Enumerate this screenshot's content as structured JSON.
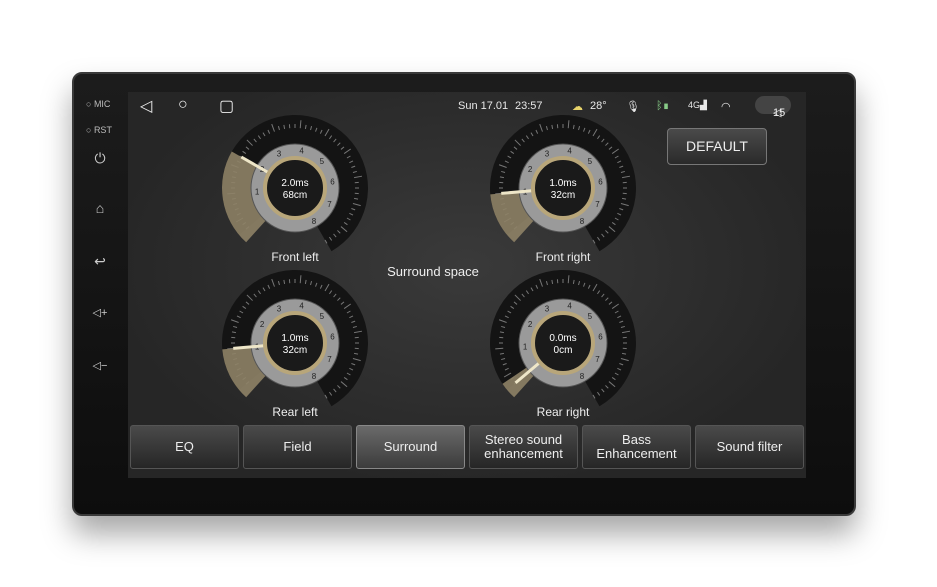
{
  "side": {
    "mic": "MIC",
    "rst": "RST",
    "icons": [
      "power-icon",
      "home-icon",
      "back-icon",
      "volume-up-icon",
      "volume-down-icon"
    ]
  },
  "status": {
    "date": "Sun 17.01",
    "time": "23:57",
    "temperature": "28°",
    "volume": "15",
    "icons": [
      "back-nav-icon",
      "home-nav-icon",
      "recents-nav-icon",
      "weather-icon",
      "mic-icon",
      "bluetooth-icon",
      "signal-4g-icon",
      "wifi-icon",
      "volume-icon"
    ]
  },
  "default_label": "DEFAULT",
  "title": "Surround space",
  "gauges": [
    {
      "name": "Front left",
      "delay": "2.0ms",
      "distance": "68cm",
      "value_ms": 2.0
    },
    {
      "name": "Front right",
      "delay": "1.0ms",
      "distance": "32cm",
      "value_ms": 1.0
    },
    {
      "name": "Rear left",
      "delay": "1.0ms",
      "distance": "32cm",
      "value_ms": 1.0
    },
    {
      "name": "Rear right",
      "delay": "0.0ms",
      "distance": "0cm",
      "value_ms": 0.0
    }
  ],
  "scale_labels": [
    "1",
    "2",
    "3",
    "4",
    "5",
    "6",
    "7",
    "8"
  ],
  "accent": "#b8a67a",
  "tabs": [
    {
      "label": "EQ",
      "selected": false
    },
    {
      "label": "Field",
      "selected": false
    },
    {
      "label": "Surround",
      "selected": true
    },
    {
      "label": "Stereo sound enhancement",
      "selected": false
    },
    {
      "label": "Bass Enhancement",
      "selected": false
    },
    {
      "label": "Sound filter",
      "selected": false
    }
  ]
}
